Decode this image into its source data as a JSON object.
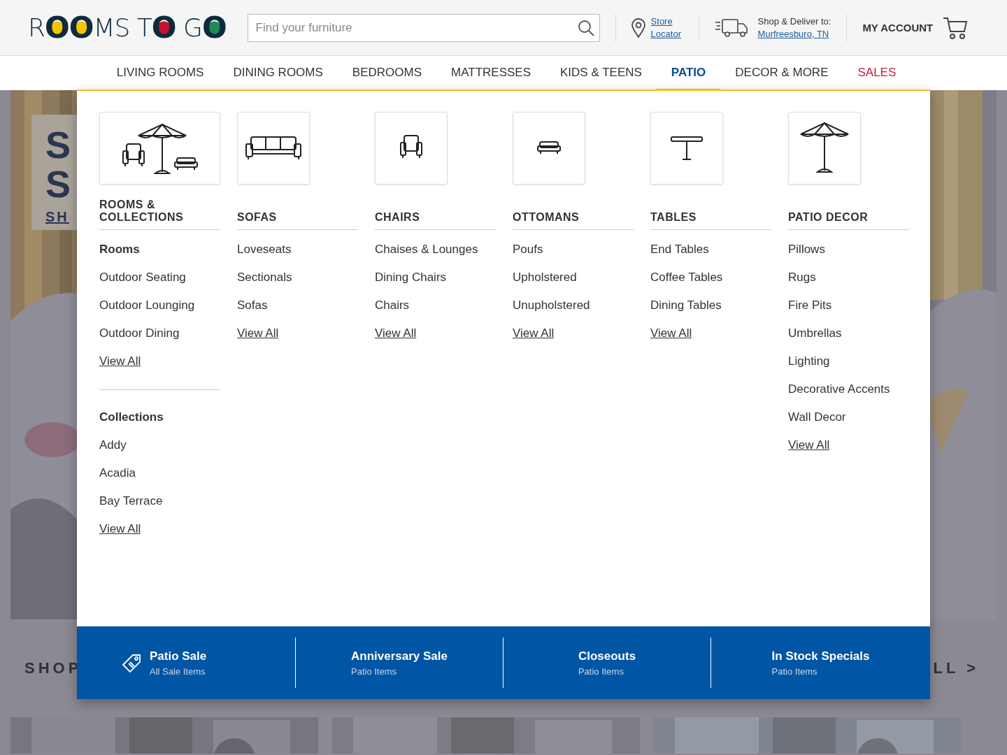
{
  "logo": [
    {
      "text": "R"
    },
    {
      "text": "O",
      "color": "#f5c400"
    },
    {
      "text": "O",
      "color": "#f5c400"
    },
    {
      "text": "MS T"
    },
    {
      "text": "O",
      "color": "#c8102e"
    },
    {
      "text": " G"
    },
    {
      "text": "O",
      "color": "#1e8a5a"
    }
  ],
  "search": {
    "placeholder": "Find your furniture"
  },
  "store_locator": "Store Locator",
  "delivery": {
    "label": "Shop & Deliver to:",
    "location": "Murfreesburo, TN"
  },
  "account": "MY ACCOUNT",
  "nav": [
    {
      "label": "LIVING ROOMS",
      "kind": "category",
      "selected": false
    },
    {
      "label": "DINING ROOMS",
      "kind": "category",
      "selected": false
    },
    {
      "label": "BEDROOMS",
      "kind": "category",
      "selected": false
    },
    {
      "label": "MATTRESSES",
      "kind": "category",
      "selected": false
    },
    {
      "label": "KIDS & TEENS",
      "kind": "category",
      "selected": false
    },
    {
      "label": "PATIO",
      "kind": "category",
      "selected": true
    },
    {
      "label": "DECOR & MORE",
      "kind": "category",
      "selected": false
    },
    {
      "label": "SALES",
      "kind": "sale",
      "selected": false
    }
  ],
  "hero": {
    "lines": [
      "S",
      "S"
    ],
    "link": "SH"
  },
  "section_heading": "SHOP",
  "view_all_link": "LL >",
  "menu": {
    "columns": [
      {
        "heading": "ROOMS & COLLECTIONS",
        "items": [
          {
            "kind": "subheading",
            "label": "Rooms"
          },
          {
            "kind": "link",
            "label": "Outdoor Seating"
          },
          {
            "kind": "link",
            "label": "Outdoor Lounging"
          },
          {
            "kind": "link",
            "label": "Outdoor Dining"
          },
          {
            "kind": "view_all",
            "label": "View All"
          },
          {
            "kind": "divider"
          },
          {
            "kind": "subheading",
            "label": "Collections"
          },
          {
            "kind": "link",
            "label": "Addy"
          },
          {
            "kind": "link",
            "label": "Acadia"
          },
          {
            "kind": "link",
            "label": "Bay Terrace"
          },
          {
            "kind": "view_all",
            "label": "View All"
          }
        ]
      },
      {
        "heading": "SOFAS",
        "items": [
          {
            "kind": "link",
            "label": "Loveseats"
          },
          {
            "kind": "link",
            "label": "Sectionals"
          },
          {
            "kind": "link",
            "label": "Sofas"
          },
          {
            "kind": "view_all",
            "label": "View All"
          }
        ]
      },
      {
        "heading": "CHAIRS",
        "items": [
          {
            "kind": "link",
            "label": "Chaises & Lounges"
          },
          {
            "kind": "link",
            "label": "Dining Chairs"
          },
          {
            "kind": "link",
            "label": "Chairs"
          },
          {
            "kind": "view_all",
            "label": "View All"
          }
        ]
      },
      {
        "heading": "OTTOMANS",
        "items": [
          {
            "kind": "link",
            "label": "Poufs"
          },
          {
            "kind": "link",
            "label": "Upholstered"
          },
          {
            "kind": "link",
            "label": "Unupholstered"
          },
          {
            "kind": "view_all",
            "label": "View All"
          }
        ]
      },
      {
        "heading": "TABLES",
        "items": [
          {
            "kind": "link",
            "label": "End Tables"
          },
          {
            "kind": "link",
            "label": "Coffee Tables"
          },
          {
            "kind": "link",
            "label": "Dining Tables"
          },
          {
            "kind": "view_all",
            "label": "View All"
          }
        ]
      },
      {
        "heading": "PATIO DECOR",
        "items": [
          {
            "kind": "link",
            "label": "Pillows"
          },
          {
            "kind": "link",
            "label": "Rugs"
          },
          {
            "kind": "link",
            "label": "Fire Pits"
          },
          {
            "kind": "link",
            "label": "Umbrellas"
          },
          {
            "kind": "link",
            "label": "Lighting"
          },
          {
            "kind": "link",
            "label": "Decorative Accents"
          },
          {
            "kind": "link",
            "label": "Wall Decor"
          },
          {
            "kind": "view_all",
            "label": "View All"
          }
        ]
      }
    ]
  },
  "promos": [
    {
      "title": "Patio Sale",
      "subtitle": "All Sale Items",
      "tag_icon": true
    },
    {
      "title": "Anniversary Sale",
      "subtitle": "Patio Items",
      "tag_icon": false
    },
    {
      "title": "Closeouts",
      "subtitle": "Patio Items",
      "tag_icon": false
    },
    {
      "title": "In Stock Specials",
      "subtitle": "Patio Items",
      "tag_icon": false
    }
  ]
}
